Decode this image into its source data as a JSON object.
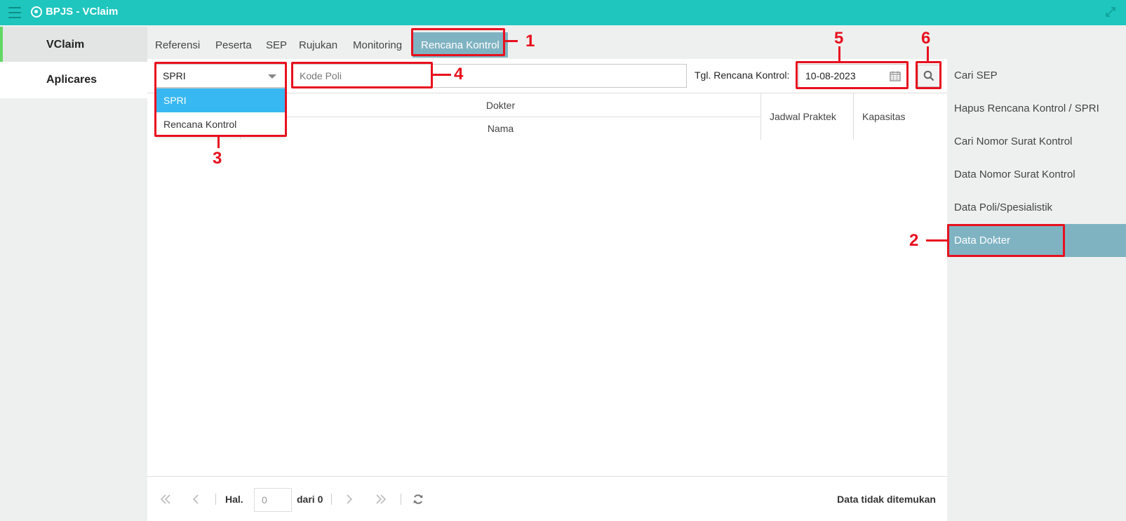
{
  "app": {
    "title": "BPJS - VClaim"
  },
  "left_nav": {
    "items": [
      {
        "label": "VClaim"
      },
      {
        "label": "Aplicares"
      }
    ]
  },
  "tabs": [
    {
      "label": "Referensi"
    },
    {
      "label": "Peserta"
    },
    {
      "label": "SEP"
    },
    {
      "label": "Rujukan"
    },
    {
      "label": "Monitoring"
    },
    {
      "label": "Rencana Kontrol",
      "active": true
    }
  ],
  "filter": {
    "type_select": {
      "value": "SPRI",
      "options": [
        "SPRI",
        "Rencana Kontrol"
      ]
    },
    "poli_input": {
      "placeholder": "Kode Poli",
      "value": ""
    },
    "date_label": "Tgl. Rencana Kontrol:",
    "date_value": "10-08-2023"
  },
  "table": {
    "group_header": "Dokter",
    "columns": [
      "Nama",
      "Jadwal Praktek",
      "Kapasitas"
    ]
  },
  "pager": {
    "page_label": "Hal.",
    "page_value": "0",
    "of_label": "dari 0",
    "status": "Data tidak ditemukan"
  },
  "right_nav": {
    "items": [
      {
        "label": "Cari SEP"
      },
      {
        "label": "Hapus Rencana Kontrol / SPRI"
      },
      {
        "label": "Cari Nomor Surat Kontrol"
      },
      {
        "label": "Data Nomor Surat Kontrol"
      },
      {
        "label": "Data Poli/Spesialistik"
      },
      {
        "label": "Data Dokter",
        "active": true
      }
    ]
  },
  "annotations": [
    "1",
    "2",
    "3",
    "4",
    "5",
    "6"
  ],
  "colors": {
    "header": "#1ec6be",
    "active_tab": "#7fb3c2",
    "dropdown_selected": "#38b8f2",
    "annotation": "#e8101e",
    "sidebar_indicator": "#62d764"
  }
}
